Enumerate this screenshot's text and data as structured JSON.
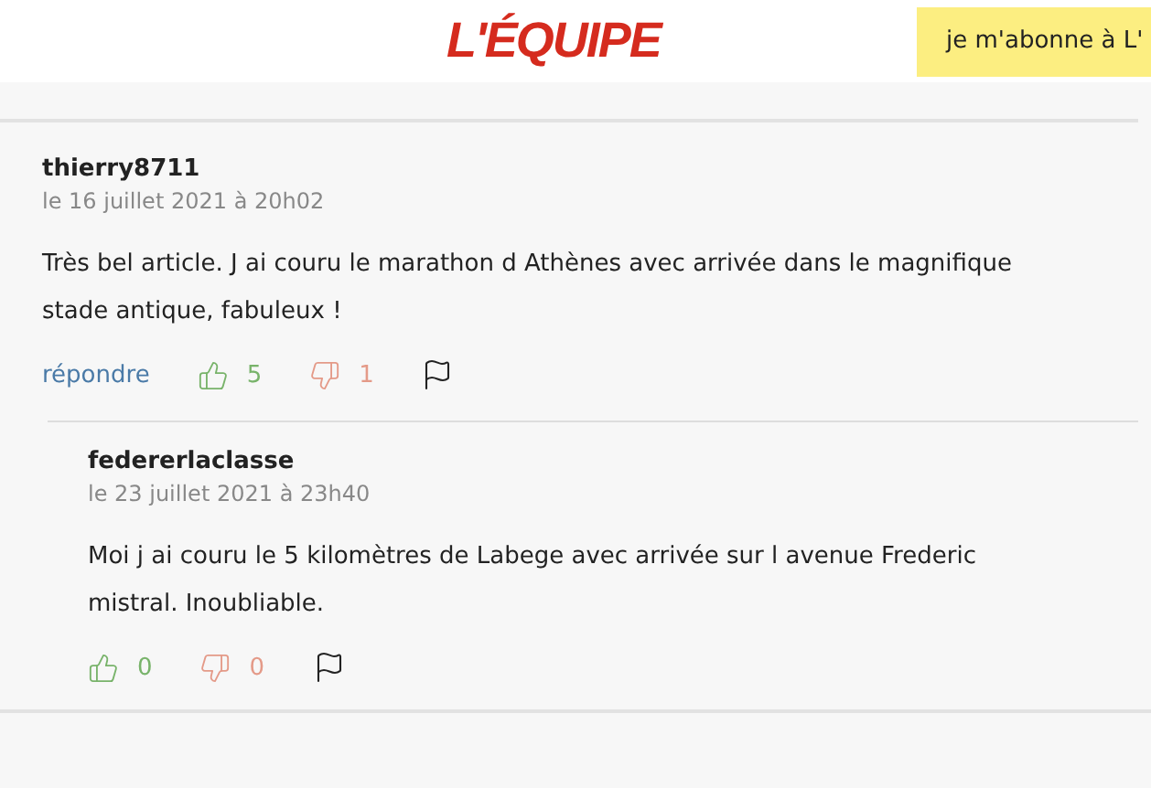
{
  "header": {
    "logo": "L'ÉQUIPE",
    "subscribe": "je m'abonne à L'"
  },
  "comments": [
    {
      "author": "thierry8711",
      "date": "le 16 juillet 2021 à 20h02",
      "text": "Très bel article. J ai couru le marathon d Athènes avec arrivée dans le magnifique stade antique, fabuleux !",
      "reply": "répondre",
      "likes": "5",
      "dislikes": "1",
      "nested": false
    },
    {
      "author": "federerlaclasse",
      "date": "le 23 juillet 2021 à 23h40",
      "text": "Moi j ai couru le 5 kilomètres de Labege avec arrivée sur l avenue Frederic mistral. Inoubliable.",
      "likes": "0",
      "dislikes": "0",
      "nested": true
    }
  ]
}
